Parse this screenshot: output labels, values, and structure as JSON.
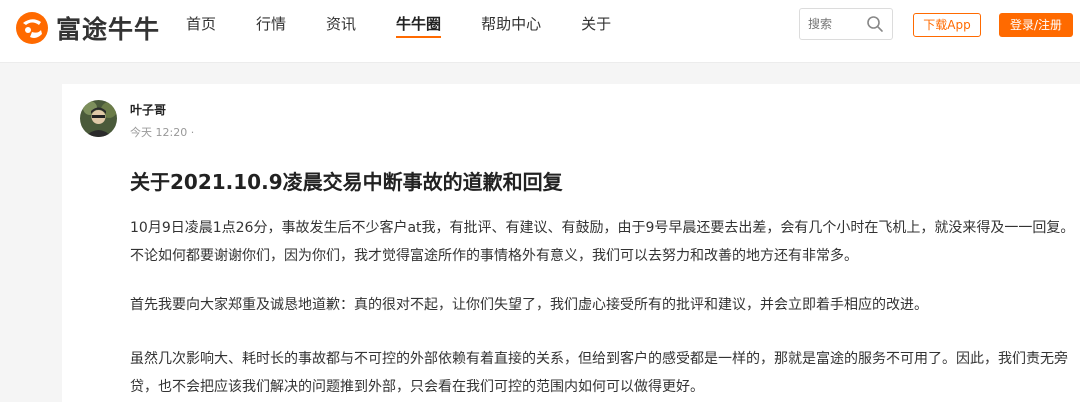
{
  "header": {
    "logo_text": "富途牛牛",
    "nav": [
      {
        "label": "首页",
        "active": false
      },
      {
        "label": "行情",
        "active": false
      },
      {
        "label": "资讯",
        "active": false
      },
      {
        "label": "牛牛圈",
        "active": true
      },
      {
        "label": "帮助中心",
        "active": false
      },
      {
        "label": "关于",
        "active": false
      }
    ],
    "search_placeholder": "搜索",
    "download_label": "下载App",
    "login_label": "登录/注册"
  },
  "post": {
    "author": "叶子哥",
    "time": "今天 12:20 ·",
    "title": "关于2021.10.9凌晨交易中断事故的道歉和回复",
    "paragraphs": [
      "10月9日凌晨1点26分，事故发生后不少客户at我，有批评、有建议、有鼓励，由于9号早晨还要去出差，会有几个小时在飞机上，就没来得及一一回复。不论如何都要谢谢你们，因为你们，我才觉得富途所作的事情格外有意义，我们可以去努力和改善的地方还有非常多。",
      "首先我要向大家郑重及诚恳地道歉：真的很对不起，让你们失望了，我们虚心接受所有的批评和建议，并会立即着手相应的改进。",
      "虽然几次影响大、耗时长的事故都与不可控的外部依赖有着直接的关系，但给到客户的感受都是一样的，那就是富途的服务不可用了。因此，我们责无旁贷，也不会把应该我们解决的问题推到外部，只会看在我们可控的范围内如何可以做得更好。"
    ]
  },
  "colors": {
    "brand": "#ff6a00",
    "text": "#222222",
    "muted": "#999999",
    "page_bg": "#f5f5f5"
  },
  "icons": {
    "logo": "futu-logo-icon",
    "search": "search-icon",
    "avatar": "user-avatar"
  }
}
